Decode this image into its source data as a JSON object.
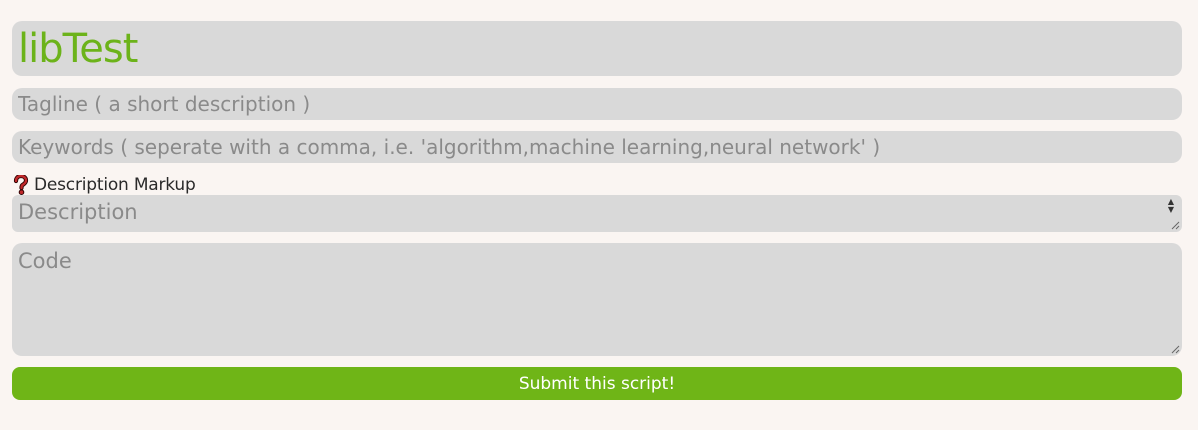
{
  "form": {
    "title_value": "libTest",
    "tagline_placeholder": "Tagline ( a short description )",
    "keywords_placeholder": "Keywords ( seperate with a comma, i.e. 'algorithm,machine learning,neural network' )",
    "markup_label": "Description Markup",
    "help_icon": "question-mark-icon",
    "description_placeholder": "Description",
    "code_placeholder": "Code",
    "submit_label": "Submit this script!"
  },
  "colors": {
    "accent": "#6fb517",
    "field_bg": "#d9d9d9",
    "page_bg": "#faf5f2",
    "placeholder": "#8a8a8a"
  }
}
